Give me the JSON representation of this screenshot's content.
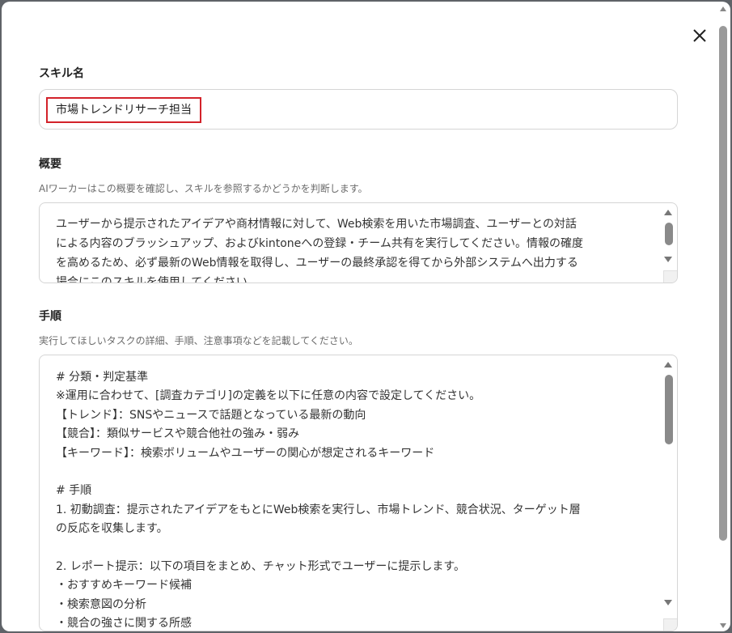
{
  "dialog": {
    "close_icon": "close-icon",
    "skill_name": {
      "label": "スキル名",
      "value": "市場トレンドリサーチ担当"
    },
    "overview": {
      "label": "概要",
      "description": "AIワーカーはこの概要を確認し、スキルを参照するかどうかを判断します。",
      "text": "ユーザーから提示されたアイデアや商材情報に対して、Web検索を用いた市場調査、ユーザーとの対話\nによる内容のブラッシュアップ、およびkintoneへの登録・チーム共有を実行してください。情報の確度\nを高めるため、必ず最新のWeb情報を取得し、ユーザーの最終承認を得てから外部システムへ出力する\n場合にこのスキルを使用してください。"
    },
    "procedure": {
      "label": "手順",
      "description": "実行してほしいタスクの詳細、手順、注意事項などを記載してください。",
      "text": "# 分類・判定基準\n※運用に合わせて、[調査カテゴリ]の定義を以下に任意の内容で設定してください。\n【トレンド】：SNSやニュースで話題となっている最新の動向\n【競合】：類似サービスや競合他社の強み・弱み\n【キーワード】：検索ボリュームやユーザーの関心が想定されるキーワード\n\n# 手順\n1. 初動調査：提示されたアイデアをもとにWeb検索を実行し、市場トレンド、競合状況、ターゲット層\nの反応を収集します。\n\n2. レポート提示：以下の項目をまとめ、チャット形式でユーザーに提示します。\n・おすすめキーワード候補\n・検索意図の分析\n・競合の強さに関する所感"
    }
  }
}
